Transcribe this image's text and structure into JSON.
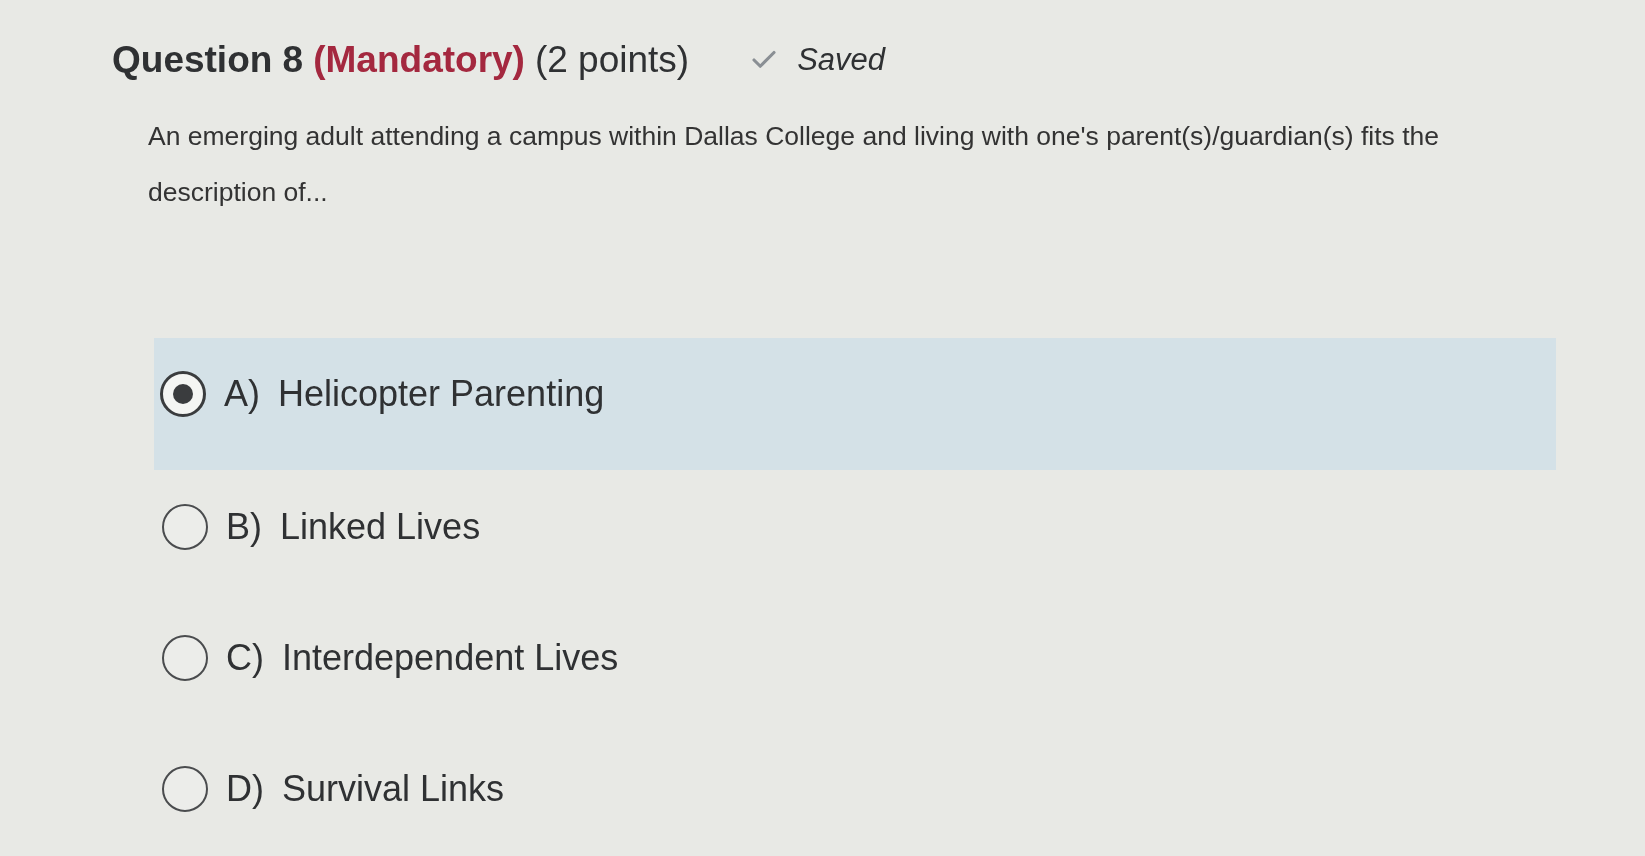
{
  "header": {
    "question": "Question 8",
    "mandatory": "(Mandatory)",
    "points": "(2 points)",
    "status": "Saved"
  },
  "prompt": "An emerging adult attending a campus within Dallas College and living with one's parent(s)/guardian(s) fits the description of...",
  "options": [
    {
      "letter": "A)",
      "text": "Helicopter Parenting",
      "selected": true
    },
    {
      "letter": "B)",
      "text": "Linked Lives",
      "selected": false
    },
    {
      "letter": "C)",
      "text": "Interdependent Lives",
      "selected": false
    },
    {
      "letter": "D)",
      "text": "Survival Links",
      "selected": false
    }
  ]
}
